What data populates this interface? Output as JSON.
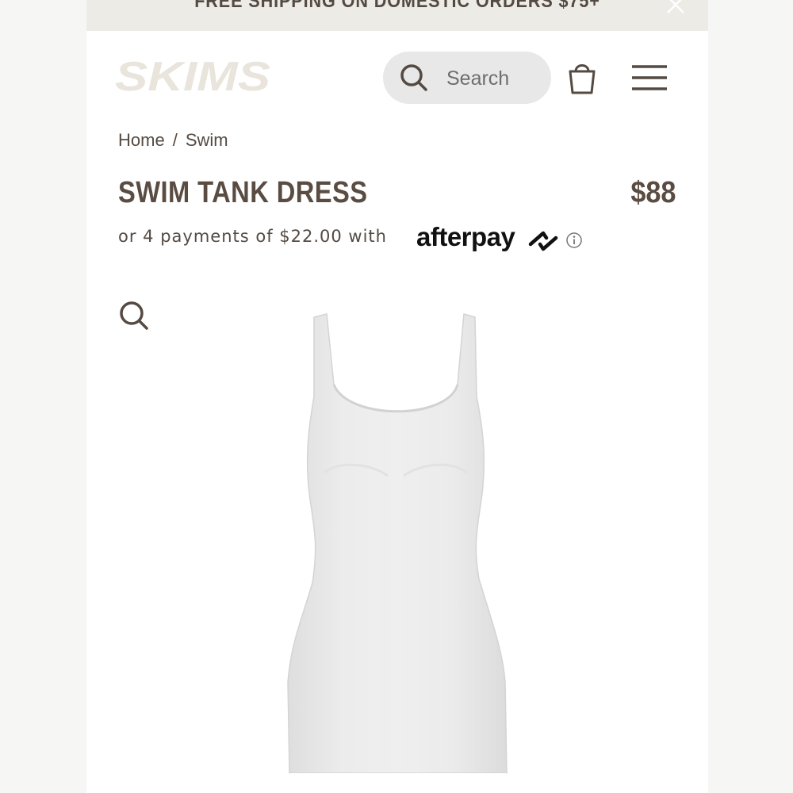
{
  "banner": {
    "text": "FREE SHIPPING ON DOMESTIC ORDERS $75+",
    "close_icon": "close-icon"
  },
  "header": {
    "logo_text": "SKIMS",
    "search": {
      "placeholder": "Search",
      "value": "",
      "icon": "search-icon"
    },
    "bag_icon": "shopping-bag-icon",
    "menu_icon": "hamburger-menu-icon"
  },
  "breadcrumb": {
    "items": [
      "Home",
      "Swim"
    ],
    "separator": "/"
  },
  "product": {
    "title": "SWIM TANK DRESS",
    "price": "$88",
    "payments_text": "or 4 payments of $22.00 with",
    "payment_provider": "afterpay",
    "info_icon": "info-icon",
    "zoom_icon": "magnifier-icon",
    "image": "white-tank-dress"
  },
  "colors": {
    "brand_text": "#5a4c42",
    "banner_bg": "#ecebe6",
    "search_bg": "#e8e8e8",
    "logo": "#e9e5dc"
  }
}
